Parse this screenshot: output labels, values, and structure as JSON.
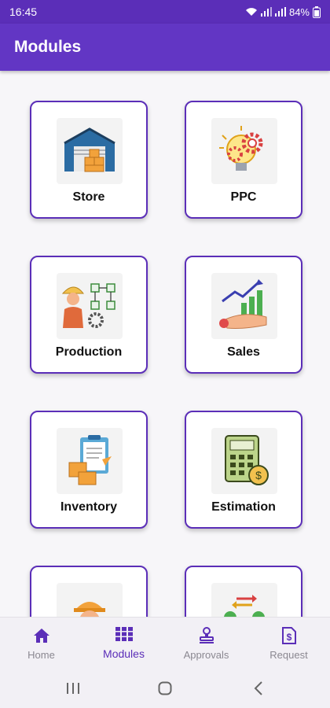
{
  "status_bar": {
    "time": "16:45",
    "battery": "84%"
  },
  "app_bar": {
    "title": "Modules"
  },
  "modules": [
    {
      "label": "Store",
      "icon": "warehouse-icon"
    },
    {
      "label": "PPC",
      "icon": "lightbulb-gears-icon"
    },
    {
      "label": "Production",
      "icon": "worker-flowchart-icon"
    },
    {
      "label": "Sales",
      "icon": "hand-growth-chart-icon"
    },
    {
      "label": "Inventory",
      "icon": "clipboard-boxes-icon"
    },
    {
      "label": "Estimation",
      "icon": "calculator-dollar-icon"
    },
    {
      "label": "",
      "icon": "worker-helmet-icon"
    },
    {
      "label": "",
      "icon": "people-exchange-icon"
    }
  ],
  "bottom_nav": {
    "items": [
      {
        "label": "Home",
        "icon": "home-icon",
        "active": false
      },
      {
        "label": "Modules",
        "icon": "grid-icon",
        "active": true
      },
      {
        "label": "Approvals",
        "icon": "stamp-icon",
        "active": false
      },
      {
        "label": "Request",
        "icon": "dollar-document-icon",
        "active": false
      }
    ]
  },
  "colors": {
    "primary": "#6236c4",
    "status_bar": "#5b2eb8",
    "card_border": "#5b2eb8",
    "background": "#f7f6f9"
  }
}
